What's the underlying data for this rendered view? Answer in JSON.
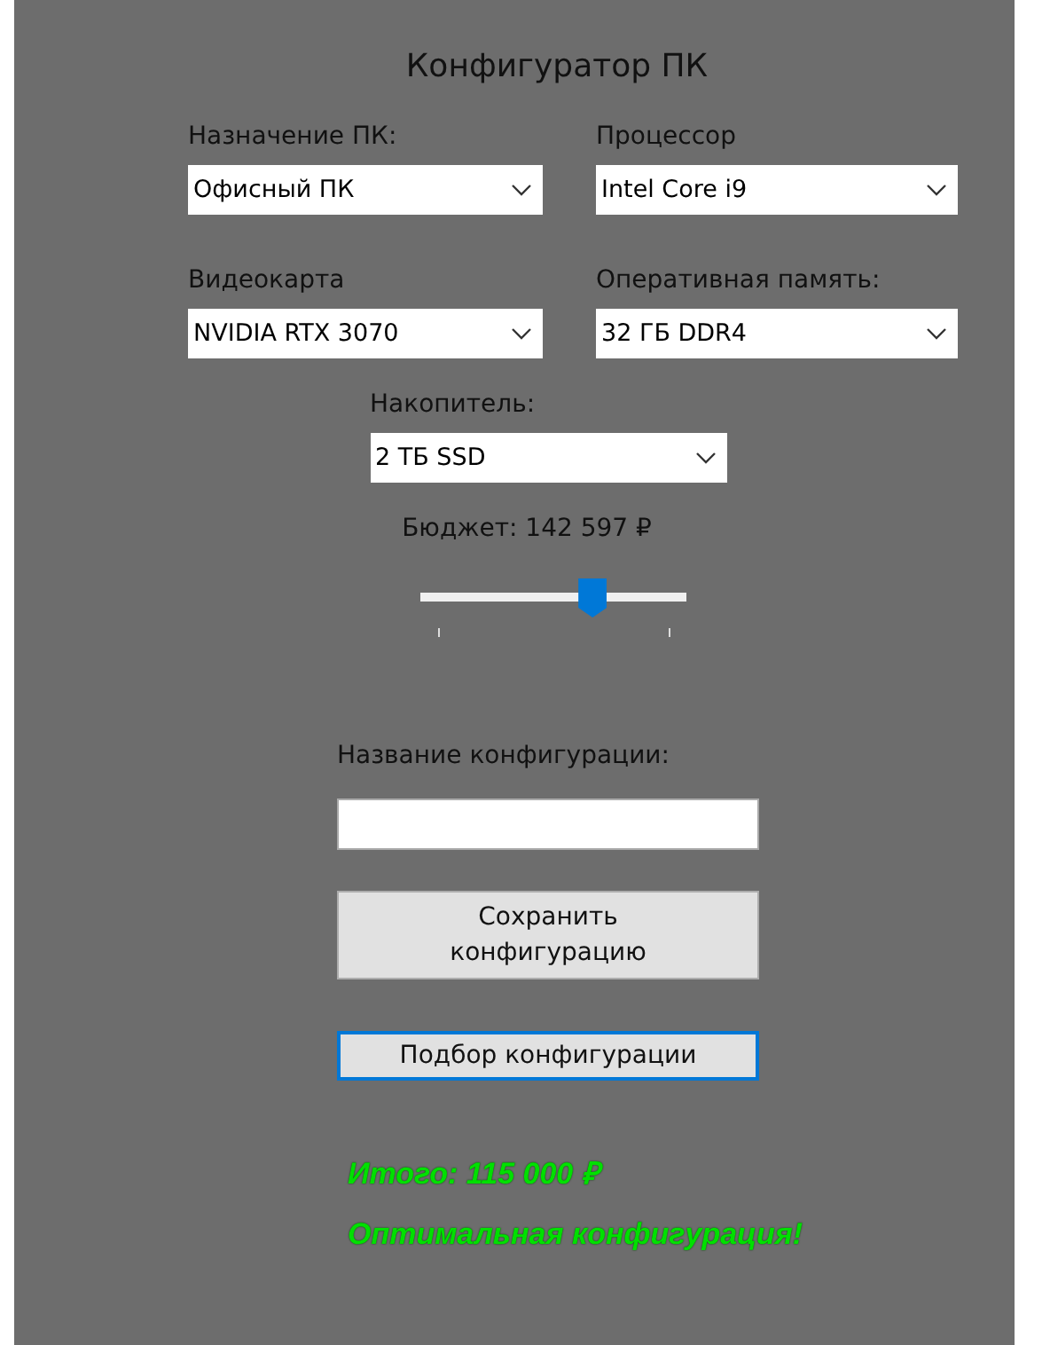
{
  "window": {
    "title": "Конфигуратор ПК"
  },
  "selectors": [
    {
      "label": "Назначение ПК:",
      "value": "Офисный ПК"
    },
    {
      "label": "Процессор",
      "value": "Intel Core i9"
    },
    {
      "label": "Видеокарта",
      "value": "NVIDIA RTX 3070"
    },
    {
      "label": "Оперативная память:",
      "value": "32 ГБ DDR4"
    },
    {
      "label": "Накопитель:",
      "value": "2 ТБ SSD"
    }
  ],
  "budget": {
    "label": "Бюджет: 142 597 ₽",
    "level": 0.67
  },
  "config_name": {
    "label": "Название конфигурации:"
  },
  "buttons": [
    {
      "label": "Сохранить конфигурацию",
      "focused": false
    },
    {
      "label": "Подбор конфигурации",
      "focused": true
    }
  ],
  "results": [
    {
      "text": "Итого: 115 000 ₽"
    },
    {
      "text": "Оптимальная конфигурация!"
    }
  ]
}
